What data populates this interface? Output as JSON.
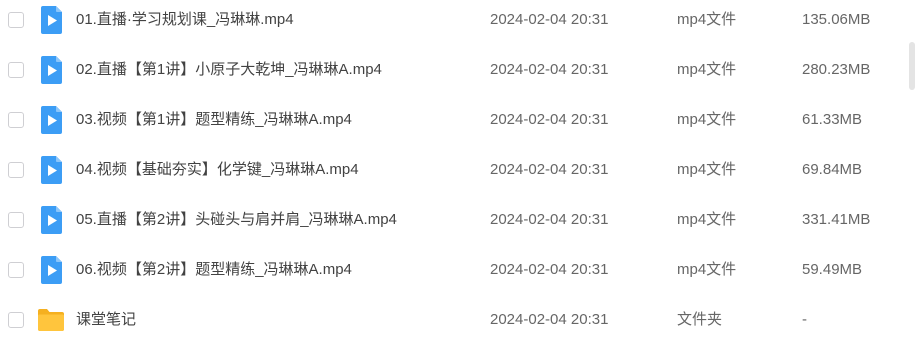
{
  "file_list": {
    "rows": [
      {
        "name": "01.直播·学习规划课_冯琳琳.mp4",
        "date": "2024-02-04 20:31",
        "type": "mp4文件",
        "size": "135.06MB",
        "icon": "video-file-icon"
      },
      {
        "name": "02.直播【第1讲】小原子大乾坤_冯琳琳A.mp4",
        "date": "2024-02-04 20:31",
        "type": "mp4文件",
        "size": "280.23MB",
        "icon": "video-file-icon"
      },
      {
        "name": "03.视频【第1讲】题型精练_冯琳琳A.mp4",
        "date": "2024-02-04 20:31",
        "type": "mp4文件",
        "size": "61.33MB",
        "icon": "video-file-icon"
      },
      {
        "name": "04.视频【基础夯实】化学键_冯琳琳A.mp4",
        "date": "2024-02-04 20:31",
        "type": "mp4文件",
        "size": "69.84MB",
        "icon": "video-file-icon"
      },
      {
        "name": "05.直播【第2讲】头碰头与肩并肩_冯琳琳A.mp4",
        "date": "2024-02-04 20:31",
        "type": "mp4文件",
        "size": "331.41MB",
        "icon": "video-file-icon"
      },
      {
        "name": "06.视频【第2讲】题型精练_冯琳琳A.mp4",
        "date": "2024-02-04 20:31",
        "type": "mp4文件",
        "size": "59.49MB",
        "icon": "video-file-icon"
      },
      {
        "name": "课堂笔记",
        "date": "2024-02-04 20:31",
        "type": "文件夹",
        "size": "-",
        "icon": "folder-icon"
      }
    ]
  },
  "colors": {
    "video_icon": "#3c9df5",
    "folder_icon": "#ffc53d",
    "checkbox_border": "#cfcfd3"
  }
}
